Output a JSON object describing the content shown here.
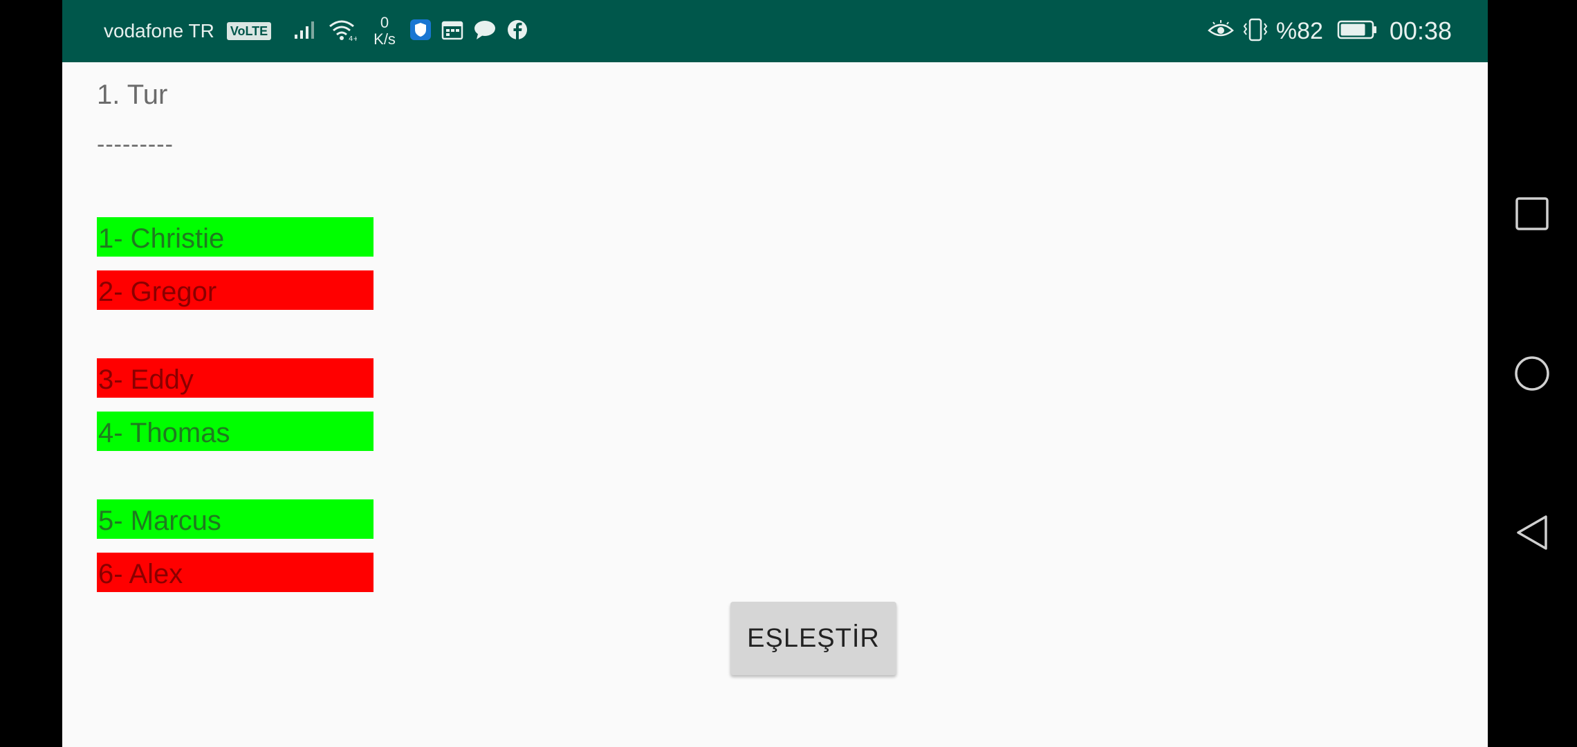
{
  "status_bar": {
    "carrier": "vodafone TR",
    "volte_badge": "VoLTE",
    "network_speed_value": "0",
    "network_speed_unit": "K/s",
    "battery_percent": "%82",
    "time": "00:38",
    "background_color": "#00574B",
    "left_icons": [
      "signal-icon",
      "wifi-icon",
      "shield-icon",
      "calendar-icon",
      "chat-icon",
      "facebook-icon"
    ],
    "right_icons": [
      "eye-comfort-icon",
      "vibrate-icon",
      "battery-icon"
    ]
  },
  "game": {
    "round_title": "1. Tur",
    "separator": "---------",
    "players": [
      {
        "label": "1- Christie",
        "status_color": "#00FF00",
        "text_color": "#1f7a1f"
      },
      {
        "label": "2- Gregor",
        "status_color": "#FF0000",
        "text_color": "#8a0000"
      },
      {
        "label": "3- Eddy",
        "status_color": "#FF0000",
        "text_color": "#8a0000"
      },
      {
        "label": "4- Thomas",
        "status_color": "#00FF00",
        "text_color": "#1f7a1f"
      },
      {
        "label": "5- Marcus",
        "status_color": "#00FF00",
        "text_color": "#1f7a1f"
      },
      {
        "label": "6- Alex",
        "status_color": "#FF0000",
        "text_color": "#8a0000"
      }
    ],
    "match_button_label": "EŞLEŞTİR"
  },
  "navigation": {
    "buttons": [
      "recents-square-icon",
      "home-circle-icon",
      "back-triangle-icon"
    ]
  }
}
